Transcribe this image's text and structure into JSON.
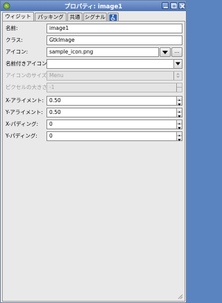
{
  "window": {
    "title": "プロパティ: image1",
    "colors": {
      "titlebar": "#5a7fbd",
      "panel": "#e9e9e9"
    }
  },
  "tabs": [
    {
      "label": "ウィジット",
      "active": true
    },
    {
      "label": "パッキング",
      "active": false
    },
    {
      "label": "共通",
      "active": false
    },
    {
      "label": "シグナル",
      "active": false
    },
    {
      "icon": "accessibility-icon",
      "active": false
    }
  ],
  "fields": {
    "name": {
      "label": "名前:",
      "value": "image1"
    },
    "class": {
      "label": "クラス:",
      "value": "GtkImage"
    },
    "icon": {
      "label": "アイコン:",
      "value": "sample_icon.png",
      "browse_label": "..."
    },
    "named_icon": {
      "label": "名前付きアイコン",
      "value": ""
    },
    "icon_size": {
      "label": "アイコンのサイズ",
      "value": "Menu",
      "disabled": true
    },
    "pixel_size": {
      "label": "ピクセルの大きさ",
      "value": "-1",
      "disabled": true
    },
    "xalign": {
      "label": "X-アライメント:",
      "value": "0.50"
    },
    "yalign": {
      "label": "Y-アライメント:",
      "value": "0.50"
    },
    "xpad": {
      "label": "X-パディング:",
      "value": "0"
    },
    "ypad": {
      "label": "Y-パディング:",
      "value": "0"
    }
  }
}
